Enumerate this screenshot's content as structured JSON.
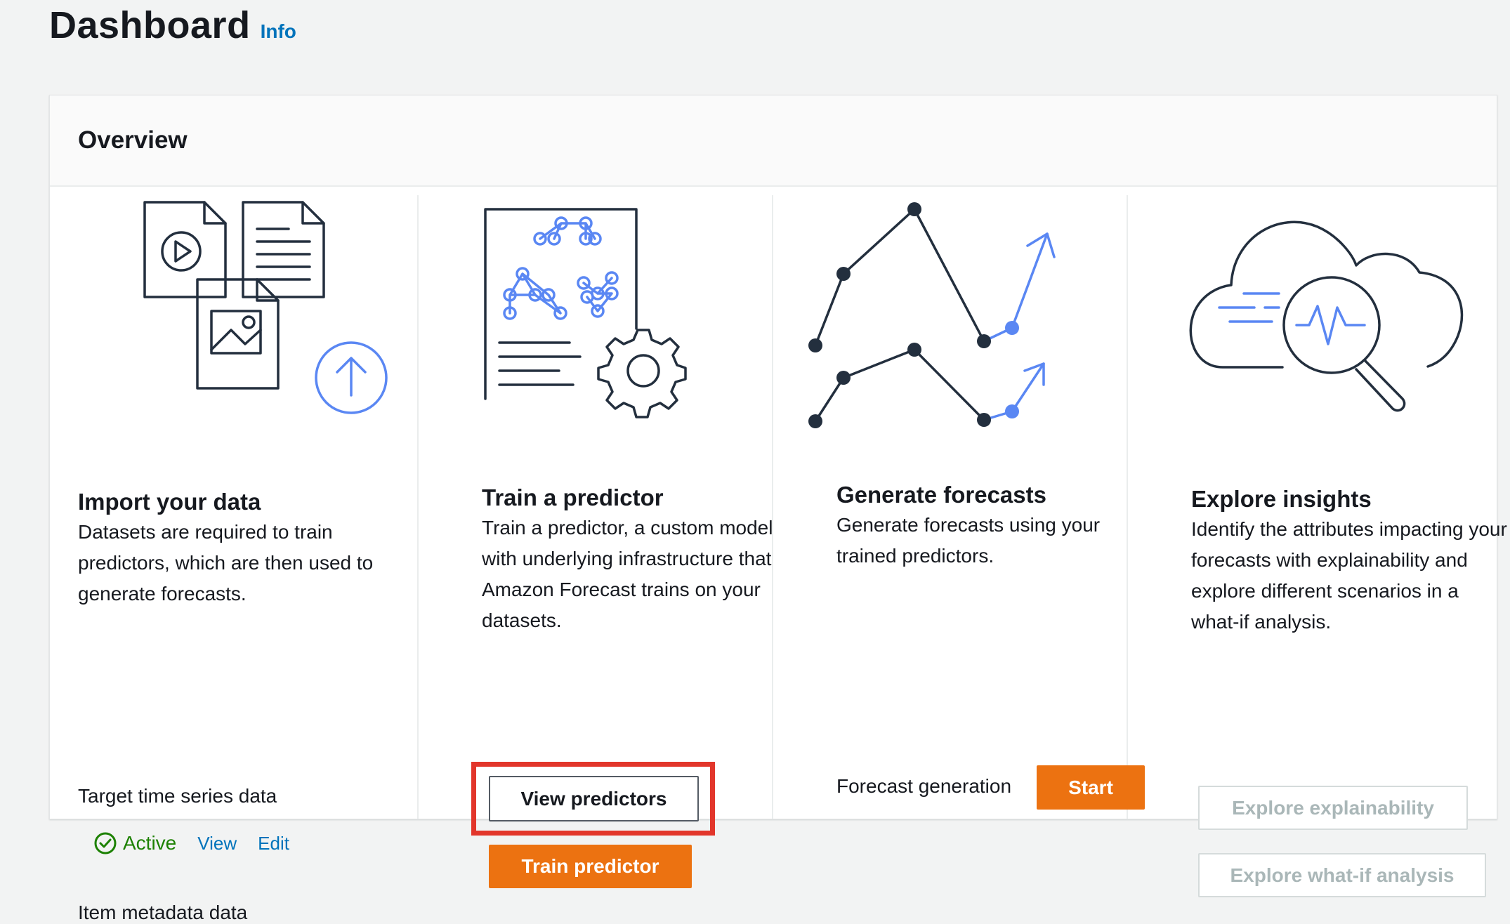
{
  "header": {
    "title": "Dashboard",
    "info_label": "Info"
  },
  "overview": {
    "title": "Overview"
  },
  "steps": {
    "import": {
      "title": "Import your data",
      "description": "Datasets are required to train predictors, which are then used to generate forecasts.",
      "dataset_label": "Target time series data",
      "status": "Active",
      "view_label": "View",
      "edit_label": "Edit",
      "next_label_partial": "Item metadata data"
    },
    "train": {
      "title": "Train a predictor",
      "description": "Train a predictor, a custom model with underlying infrastructure that Amazon Forecast trains on your datasets.",
      "view_button": "View predictors",
      "train_button": "Train predictor"
    },
    "generate": {
      "title": "Generate forecasts",
      "description": "Generate forecasts using your trained predictors.",
      "row_label": "Forecast generation",
      "start_button": "Start"
    },
    "explore": {
      "title": "Explore insights",
      "description": "Identify the attributes impacting your forecasts with explainability and explore different scenarios in a what-if analysis.",
      "explainability_button": "Explore explainability",
      "whatif_button": "Explore what-if analysis"
    }
  },
  "colors": {
    "accent_blue": "#5a87f3",
    "primary_orange": "#ec7211",
    "active_green": "#1d8102",
    "link_blue": "#0073bb",
    "highlight_red": "#e2362b"
  },
  "icons": {
    "import": "documents-upload-icon",
    "train": "model-gear-icon",
    "generate": "forecast-chart-icon",
    "explore": "cloud-magnifier-icon",
    "status": "check-circle-icon"
  }
}
